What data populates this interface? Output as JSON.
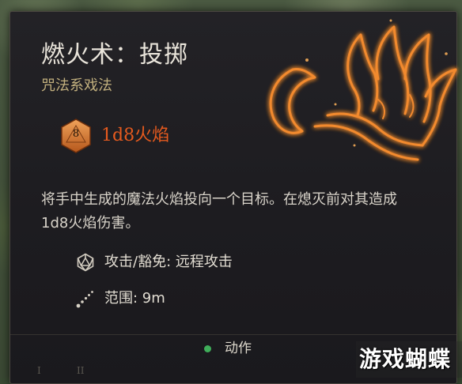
{
  "spell": {
    "name": "燃火术：投掷",
    "school": "咒法系戏法",
    "damage_die_face": "8",
    "damage": "1d8火焰",
    "description": "将手中生成的魔法火焰投向一个目标。在熄灭前对其造成1d8火焰伤害。",
    "attack_save": "攻击/豁免: 远程攻击",
    "range": "范围:  9m",
    "action_cost": "动作"
  },
  "level_markers": [
    "I",
    "II"
  ],
  "watermark": "游戏蝴蝶",
  "icons": {
    "spell_art": "flaming-hand-icon",
    "damage_die": "d20-die-icon",
    "attack": "d20-outline-icon",
    "range": "dotted-range-icon",
    "action": "green-action-dot-icon"
  },
  "colors": {
    "panel_bg": "#1e1d21",
    "title": "#e9e4da",
    "school": "#c2b07e",
    "damage": "#e65a1e",
    "flame": "#f08a2c",
    "action_dot": "#3fae5a"
  }
}
